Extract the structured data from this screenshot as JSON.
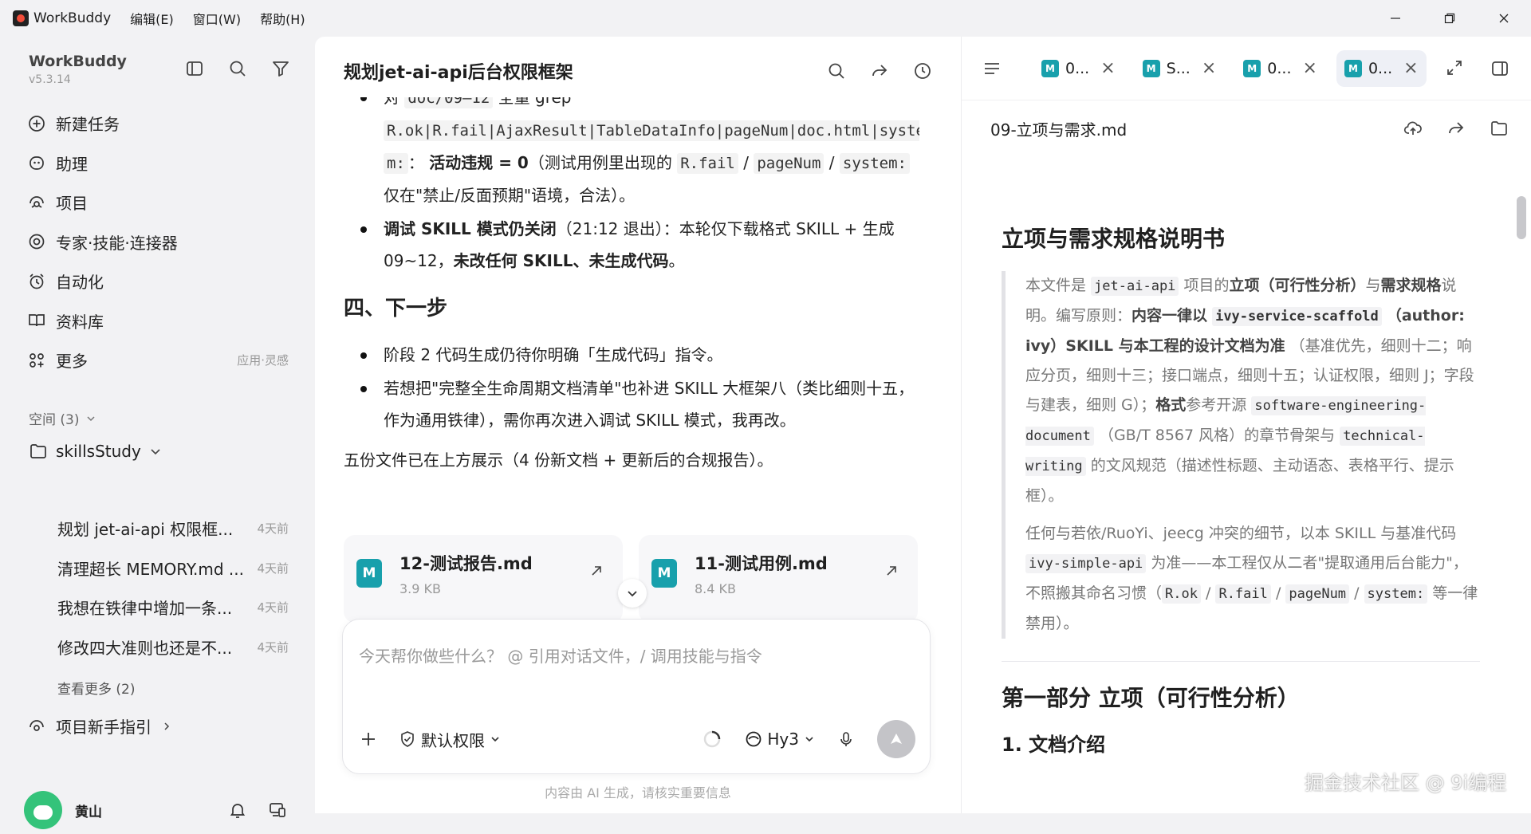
{
  "menubar": {
    "app": "WorkBuddy",
    "menus": [
      "编辑(E)",
      "窗口(W)",
      "帮助(H)"
    ]
  },
  "sidebar": {
    "title": "WorkBuddy",
    "version": "v5.3.14",
    "nav": [
      {
        "label": "新建任务",
        "icon": "plus-circle-icon"
      },
      {
        "label": "助理",
        "icon": "assistant-icon"
      },
      {
        "label": "项目",
        "icon": "project-icon"
      },
      {
        "label": "专家·技能·连接器",
        "icon": "experts-icon"
      },
      {
        "label": "自动化",
        "icon": "alarm-icon"
      },
      {
        "label": "资料库",
        "icon": "book-icon"
      },
      {
        "label": "更多",
        "icon": "grid-icon",
        "sub": "应用·灵感"
      }
    ],
    "space_label": "空间 (3)",
    "folder": "skillsStudy",
    "tasks": [
      {
        "title": "规划 jet-ai-api 权限框...",
        "time": "4天前"
      },
      {
        "title": "清理超长 MEMORY.md ...",
        "time": "4天前"
      },
      {
        "title": "我想在铁律中增加一条...",
        "time": "4天前"
      },
      {
        "title": "修改四大准则也还是不...",
        "time": "4天前"
      }
    ],
    "more_tasks": "查看更多 (2)",
    "guide": "项目新手指引",
    "user": "黄山"
  },
  "chat": {
    "title": "规划jet-ai-api后台权限框架",
    "b1_a": "对",
    "b1_b": "doc/09–12",
    "b1_c": "全量 grep",
    "b1_d": "R.ok|R.fail|AjaxResult|TableDataInfo|pageNum|doc.html|syste",
    "b1_e": "m:",
    "b1_f": "：",
    "b1_g": "活动违规 = 0",
    "b1_h": "（测试用例里出现的",
    "b1_i": "R.fail",
    "b1_j": "/",
    "b1_k": "pageNum",
    "b1_l": "/",
    "b1_m": "system:",
    "b1_n": "仅在\"禁止/反面预期\"语境，合法）。",
    "b2_a": "调试 SKILL 模式仍关闭",
    "b2_b": "（21:12 退出）：本轮仅下载格式 SKILL + 生成 09~12，",
    "b2_c": "未改任何 SKILL、未生成代码",
    "b2_d": "。",
    "h_next": "四、下一步",
    "n1": "阶段 2 代码生成仍待你明确「生成代码」指令。",
    "n2": "若想把\"完整全生命周期文档清单\"也补进 SKILL 大框架八（类比细则十五，作为通用铁律），需你再次进入调试 SKILL 模式，我再改。",
    "summary": "五份文件已在上方展示（4 份新文档 + 更新后的合规报告）。",
    "cards": [
      {
        "name": "12-测试报告.md",
        "size": "3.9 KB",
        "icon": "M"
      },
      {
        "name": "11-测试用例.md",
        "size": "8.4 KB",
        "icon": "M"
      }
    ],
    "placeholder": "今天帮你做些什么？ @ 引用对话文件，/ 调用技能与指令",
    "permission": "默认权限",
    "model": "Hy3",
    "disclaimer": "内容由 AI 生成，请核实重要信息"
  },
  "doc": {
    "tabs": [
      "0...",
      "S...",
      "0...",
      "0..."
    ],
    "file_title": "09-立项与需求.md",
    "h1": "立项与需求规格说明书",
    "q1_a": "本文件是",
    "q1_b": "jet-ai-api",
    "q1_c": "项目的",
    "q1_d": "立项（可行性分析）",
    "q1_e": "与",
    "q1_f": "需求规格",
    "q1_g": "说明。编写原则：",
    "q1_h": "内容一律以",
    "q1_i": "ivy-service-scaffold",
    "q1_j": "（author: ivy）SKILL 与本工程的设计文档为准",
    "q1_k": "（基准优先，细则十二；响应分页，细则十三；接口端点，细则十五；认证权限，细则 J；字段与建表，细则 G）；",
    "q1_l": "格式",
    "q1_m": "参考开源",
    "q1_n": "software-engineering-document",
    "q1_o": "（GB/T 8567 风格）的章节骨架与",
    "q1_p": "technical-writing",
    "q1_q": "的文风规范（描述性标题、主动语态、表格平行、提示框）。",
    "q2_a": "任何与若依/RuoYi、jeecg 冲突的细节，以本 SKILL 与基准代码",
    "q2_b": "ivy-simple-api",
    "q2_c": "为准——本工程仅从二者\"提取通用后台能力\"，不照搬其命名习惯（",
    "q2_d": "R.ok",
    "q2_e": "/",
    "q2_f": "R.fail",
    "q2_g": "/",
    "q2_h": "pageNum",
    "q2_i": "/",
    "q2_j": "system:",
    "q2_k": "等一律禁用）。",
    "h2": "第一部分 立项（可行性分析）",
    "h3": "1. 文档介绍"
  },
  "watermark": "掘金技术社区 @ 9i编程",
  "colors": {
    "md_icon": "#18a0ac",
    "avatar": "#34c37a"
  }
}
